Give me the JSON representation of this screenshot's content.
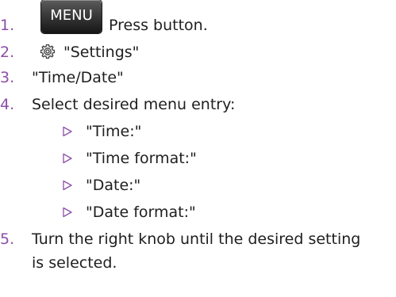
{
  "steps": [
    {
      "number": "1.",
      "button_label": "MENU",
      "text": "Press button."
    },
    {
      "number": "2.",
      "icon": "gear-icon",
      "text": "\"Settings\""
    },
    {
      "number": "3.",
      "text": "\"Time/Date\""
    },
    {
      "number": "4.",
      "text": "Select desired menu entry:"
    },
    {
      "number": "5.",
      "text_line1": "Turn the right knob until the desired setting",
      "text_line2": "is selected."
    }
  ],
  "sub_items": [
    {
      "marker_icon": "triangle-right-icon",
      "text": "\"Time:\""
    },
    {
      "marker_icon": "triangle-right-icon",
      "text": "\"Time format:\""
    },
    {
      "marker_icon": "triangle-right-icon",
      "text": "\"Date:\""
    },
    {
      "marker_icon": "triangle-right-icon",
      "text": "\"Date format:\""
    }
  ],
  "colors": {
    "step_number": "#8c4fa8",
    "text": "#1e1e1e",
    "sub_marker": "#8c4fa8",
    "button_background": "#2a2a2a",
    "button_text": "#ffffff"
  }
}
